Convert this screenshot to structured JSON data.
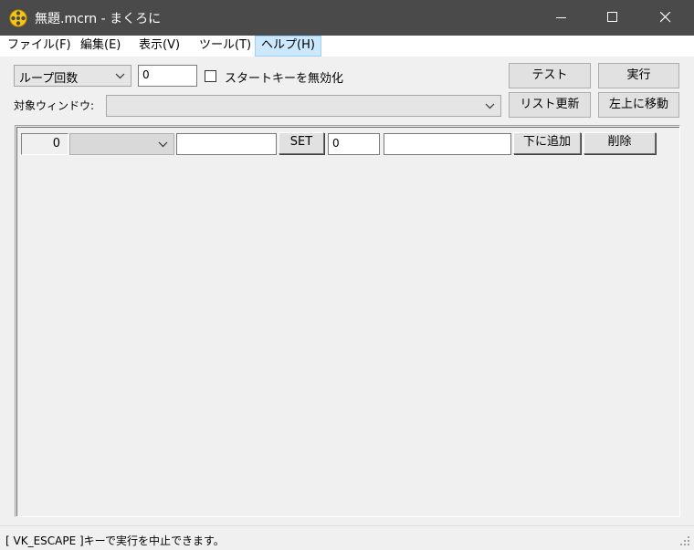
{
  "window": {
    "title": "無題.mcrn - まくろに",
    "app_icon": "film-reel-icon",
    "controls": [
      "minimize-icon",
      "maximize-icon",
      "close-icon"
    ]
  },
  "menu": {
    "items": [
      {
        "label": "ファイル(F)",
        "active": false
      },
      {
        "label": "編集(E)",
        "active": false
      },
      {
        "label": "表示(V)",
        "active": false
      },
      {
        "label": "ツール(T)",
        "active": false
      },
      {
        "label": "ヘルプ(H)",
        "active": true
      }
    ]
  },
  "toolbar": {
    "loop_mode": "ループ回数",
    "loop_count": "0",
    "start_key_disable_label": "スタートキーを無効化",
    "start_key_disable_checked": false,
    "test_button": "テスト",
    "run_button": "実行",
    "target_window_label": "対象ウィンドウ:",
    "target_window_value": "",
    "refresh_list_button": "リスト更新",
    "move_top_left_button": "左上に移動"
  },
  "rows": [
    {
      "index": "0",
      "action": "",
      "key_value": "",
      "set_button": "SET",
      "wait": "0",
      "note": "",
      "add_below_button": "下に追加",
      "delete_button": "削除"
    }
  ],
  "status": {
    "text": "[ VK_ESCAPE ]キーで実行を中止できます。"
  }
}
